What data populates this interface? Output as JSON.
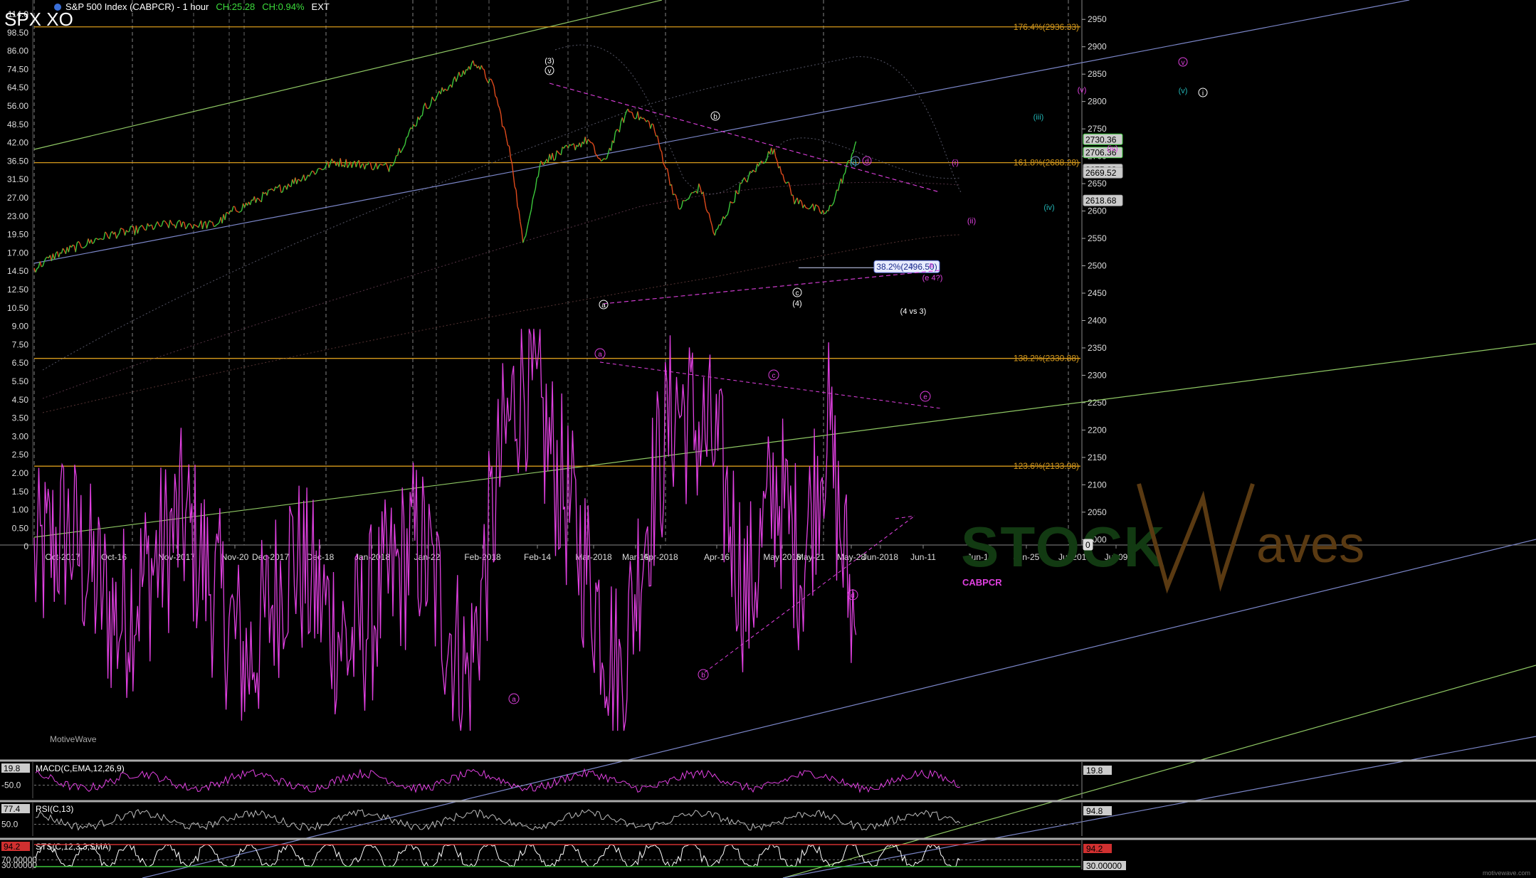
{
  "header": {
    "symbol": "SPX XO",
    "instrument": "S&P 500 Index (CABPCR) - 1 hour",
    "change_points": "CH:25.28",
    "change_percent": "CH:0.94%",
    "session": "EXT"
  },
  "watermark": {
    "part1": "STOCK",
    "part2": "aves",
    "credit": "MotiveWave",
    "footer": "motivewave.com"
  },
  "colors": {
    "price_up": "#3cc83c",
    "price_down": "#e04a1c",
    "indicator": "#e040e0",
    "fib": "#d79a1c",
    "channel_blue": "#7b86c8",
    "channel_green": "#8fc864",
    "wave_label": "#e040e0"
  },
  "chart_data": [
    {
      "type": "line",
      "title": "S&P 500 Index (CABPCR) - 1 hour",
      "series_note": "hourly candlesticks approximated from visible swing points",
      "x_tick_labels": [
        "Oct-2017",
        "Oct-16",
        "Nov-2017",
        "Nov-20",
        "Dec-2017",
        "Dec-18",
        "Jan-2018",
        "Jan-22",
        "Feb-2018",
        "Feb-14",
        "Mar-2018",
        "Mar-19",
        "Apr-2018",
        "Apr-16",
        "May-2018",
        "May-21",
        "May-28",
        "Jun-2018",
        "Jun-11",
        "Jun-18",
        "Jun-25",
        "Jul-2018",
        "Jul-09"
      ],
      "right_axis_ticks": [
        2950,
        2900,
        2850,
        2800,
        2750,
        2700,
        2650,
        2600,
        2550,
        2500,
        2450,
        2400,
        2350,
        2300,
        2250,
        2200,
        2150,
        2100,
        2050,
        2000
      ],
      "right_axis_range": [
        1990,
        2975
      ],
      "left_axis_ticks": [
        "114.0",
        "98.50",
        "86.00",
        "74.50",
        "64.50",
        "56.00",
        "48.50",
        "42.00",
        "36.50",
        "31.50",
        "27.00",
        "23.00",
        "19.50",
        "17.00",
        "14.50",
        "12.50",
        "10.50",
        "9.00",
        "7.50",
        "6.50",
        "5.50",
        "4.50",
        "3.50",
        "3.00",
        "2.50",
        "2.00",
        "1.50",
        "1.00",
        "0.50",
        "0"
      ],
      "series": [
        {
          "name": "SPX",
          "x": [
            "2017-09-26",
            "2017-10-02",
            "2017-10-16",
            "2017-11-01",
            "2017-11-15",
            "2017-11-20",
            "2017-12-04",
            "2017-12-18",
            "2018-01-02",
            "2018-01-12",
            "2018-01-26",
            "2018-01-31",
            "2018-02-05",
            "2018-02-08",
            "2018-02-13",
            "2018-02-26",
            "2018-03-02",
            "2018-03-09",
            "2018-03-16",
            "2018-03-23",
            "2018-03-29",
            "2018-04-02",
            "2018-04-09",
            "2018-04-18",
            "2018-04-24",
            "2018-05-03",
            "2018-05-08",
            "2018-05-11"
          ],
          "values": [
            2495,
            2520,
            2555,
            2575,
            2575,
            2600,
            2645,
            2690,
            2680,
            2790,
            2873,
            2825,
            2690,
            2540,
            2690,
            2730,
            2685,
            2785,
            2755,
            2605,
            2645,
            2555,
            2645,
            2712,
            2620,
            2594,
            2670,
            2727
          ]
        },
        {
          "name": "CABPCR",
          "x": [
            "2017-09-26",
            "2017-10-05",
            "2017-10-19",
            "2017-11-06",
            "2017-11-24",
            "2017-12-06",
            "2017-12-22",
            "2018-01-10",
            "2018-01-24",
            "2018-02-02",
            "2018-02-08",
            "2018-02-20",
            "2018-03-07",
            "2018-03-14",
            "2018-03-22",
            "2018-04-02",
            "2018-04-11",
            "2018-04-19",
            "2018-04-26",
            "2018-05-03",
            "2018-05-07",
            "2018-05-11"
          ],
          "values": [
            0.8,
            1.1,
            0.5,
            1.2,
            0.35,
            0.9,
            0.4,
            1.0,
            0.3,
            2.0,
            4.3,
            1.4,
            0.3,
            1.2,
            3.2,
            2.2,
            0.6,
            1.6,
            0.8,
            2.8,
            1.0,
            0.45
          ]
        }
      ],
      "fib_levels": [
        {
          "label": "176.4%(2936.33)",
          "value": 2936.33
        },
        {
          "label": "161.8%(2688.28)",
          "value": 2688.28
        },
        {
          "label": "138.2%(2330.88)",
          "value": 2330.88
        },
        {
          "label": "123.6%(2133.98)",
          "value": 2133.98
        },
        {
          "label": "38.2%(2496.50)",
          "value": 2496.5
        }
      ],
      "price_markers": [
        {
          "label": "2730.36",
          "value": 2730.36,
          "color": "#3cc83c"
        },
        {
          "label": "2706.36",
          "value": 2706.36,
          "color": "#3cc83c"
        },
        {
          "label": "2675.23",
          "value": 2675.23,
          "color": "#888888"
        },
        {
          "label": "2669.52",
          "value": 2669.52,
          "color": "#aaaaaa"
        },
        {
          "label": "2618.68",
          "value": 2618.68,
          "color": "#aaaaaa"
        },
        {
          "label": "0",
          "value": 1990,
          "color": "#dddddd"
        }
      ],
      "annotations": [
        "3",
        "v",
        "a",
        "b",
        "c",
        "d",
        "i",
        "ii",
        "iii",
        "iv",
        "v",
        "4",
        "4 vs 3",
        "e 4?",
        "CABPCR"
      ]
    },
    {
      "type": "line",
      "title": "MACD(C,EMA,12,26,9)",
      "value_label": "19.8",
      "axis_label": "-50.0",
      "marker_label": "19.8"
    },
    {
      "type": "line",
      "title": "RSI(C,13)",
      "value_label": "77.4",
      "axis_label": "50.0",
      "marker_label": "94.8"
    },
    {
      "type": "line",
      "title": "STS(C,12,3,3,SMA)",
      "value_label": "94.2",
      "axis_label_top": "70.00000",
      "axis_label_bottom": "30.00000",
      "marker_label": "94.2",
      "marker_label_bottom": "30.00000"
    }
  ]
}
